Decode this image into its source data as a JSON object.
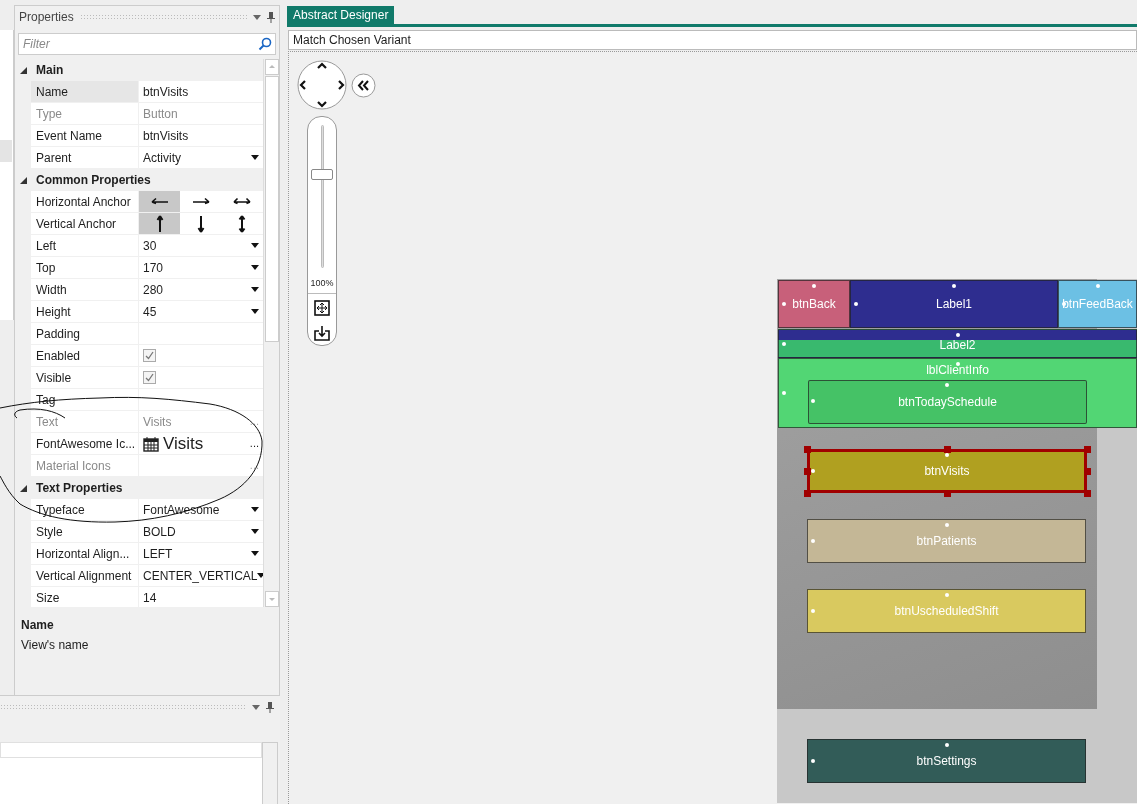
{
  "properties": {
    "title": "Properties",
    "filter": {
      "placeholder": "Filter"
    },
    "groups": [
      {
        "label": "Main",
        "expanded": true,
        "rows": [
          {
            "label": "Name",
            "kind": "text",
            "value": "btnVisits",
            "selected": true,
            "disabled": false
          },
          {
            "label": "Type",
            "kind": "text",
            "value": "Button",
            "selected": false,
            "disabled": true
          },
          {
            "label": "Event Name",
            "kind": "text",
            "value": "btnVisits",
            "selected": false,
            "disabled": false
          },
          {
            "label": "Parent",
            "kind": "dropdown",
            "value": "Activity",
            "selected": false,
            "disabled": false
          }
        ]
      },
      {
        "label": "Common Properties",
        "expanded": true,
        "rows": [
          {
            "label": "Horizontal Anchor",
            "kind": "h_anchor",
            "options": [
              {
                "selected": true
              },
              {
                "selected": false
              },
              {
                "selected": false
              }
            ],
            "selected": false,
            "disabled": false
          },
          {
            "label": "Vertical Anchor",
            "kind": "v_anchor",
            "options": [
              {
                "selected": true
              },
              {
                "selected": false
              },
              {
                "selected": false
              }
            ],
            "selected": false,
            "disabled": false
          },
          {
            "label": "Left",
            "kind": "dropdown",
            "value": "30",
            "selected": false,
            "disabled": false
          },
          {
            "label": "Top",
            "kind": "dropdown",
            "value": "170",
            "selected": false,
            "disabled": false
          },
          {
            "label": "Width",
            "kind": "dropdown",
            "value": "280",
            "selected": false,
            "disabled": false
          },
          {
            "label": "Height",
            "kind": "dropdown",
            "value": "45",
            "selected": false,
            "disabled": false
          },
          {
            "label": "Padding",
            "kind": "text",
            "selected": false,
            "disabled": false
          },
          {
            "label": "Enabled",
            "kind": "check",
            "checked": true,
            "selected": false,
            "disabled": false
          },
          {
            "label": "Visible",
            "kind": "check",
            "checked": true,
            "selected": false,
            "disabled": false
          },
          {
            "label": "Tag",
            "kind": "text",
            "selected": false,
            "disabled": false
          },
          {
            "label": "Text",
            "kind": "text",
            "value": "Visits",
            "button": "...",
            "selected": false,
            "disabled": true
          },
          {
            "label": "FontAwesome Ic...",
            "kind": "icon_text",
            "value": "Visits",
            "button": "...",
            "selected": false,
            "disabled": false
          },
          {
            "label": "Material Icons",
            "kind": "text",
            "button": "...",
            "selected": false,
            "disabled": true
          }
        ]
      },
      {
        "label": "Text Properties",
        "expanded": true,
        "rows": [
          {
            "label": "Typeface",
            "kind": "dropdown",
            "value": "FontAwesome",
            "selected": false,
            "disabled": false
          },
          {
            "label": "Style",
            "kind": "dropdown",
            "value": "BOLD",
            "selected": false,
            "disabled": false
          },
          {
            "label": "Horizontal Align...",
            "kind": "dropdown",
            "value": "LEFT",
            "selected": false,
            "disabled": false
          },
          {
            "label": "Vertical Alignment",
            "kind": "dropdown",
            "value": "CENTER_VERTICAL",
            "selected": false,
            "disabled": false
          },
          {
            "label": "Size",
            "kind": "text",
            "value": "14",
            "selected": false,
            "disabled": false
          }
        ]
      }
    ],
    "description": {
      "title": "Name",
      "text": "View's name"
    }
  },
  "designer": {
    "tab": "Abstract Designer",
    "variant": "Match Chosen Variant",
    "zoom": {
      "level": 0.68,
      "reading": "100%"
    },
    "views": [
      {
        "name": "btnBack",
        "color": "#c8607a",
        "selected": false
      },
      {
        "name": "Label1",
        "color": "#2e2d8f",
        "selected": false
      },
      {
        "name": "btnFeedBack",
        "color": "#6cc0e4",
        "selected": false
      },
      {
        "name": "Label2",
        "color": "#2e2d8f",
        "selected": false
      },
      {
        "name": "lblClientInfo",
        "color": "#52d674",
        "selected": false
      },
      {
        "name": "btnTodaySchedule",
        "color": "#45c266",
        "selected": false
      },
      {
        "name": "btnVisits",
        "color": "#b0a020",
        "selected": true
      },
      {
        "name": "btnPatients",
        "color": "#c4b796",
        "selected": false
      },
      {
        "name": "btnUscheduledShift",
        "color": "#d9c95f",
        "selected": false
      },
      {
        "name": "btnSettings",
        "color": "#325c58",
        "selected": false
      }
    ]
  }
}
